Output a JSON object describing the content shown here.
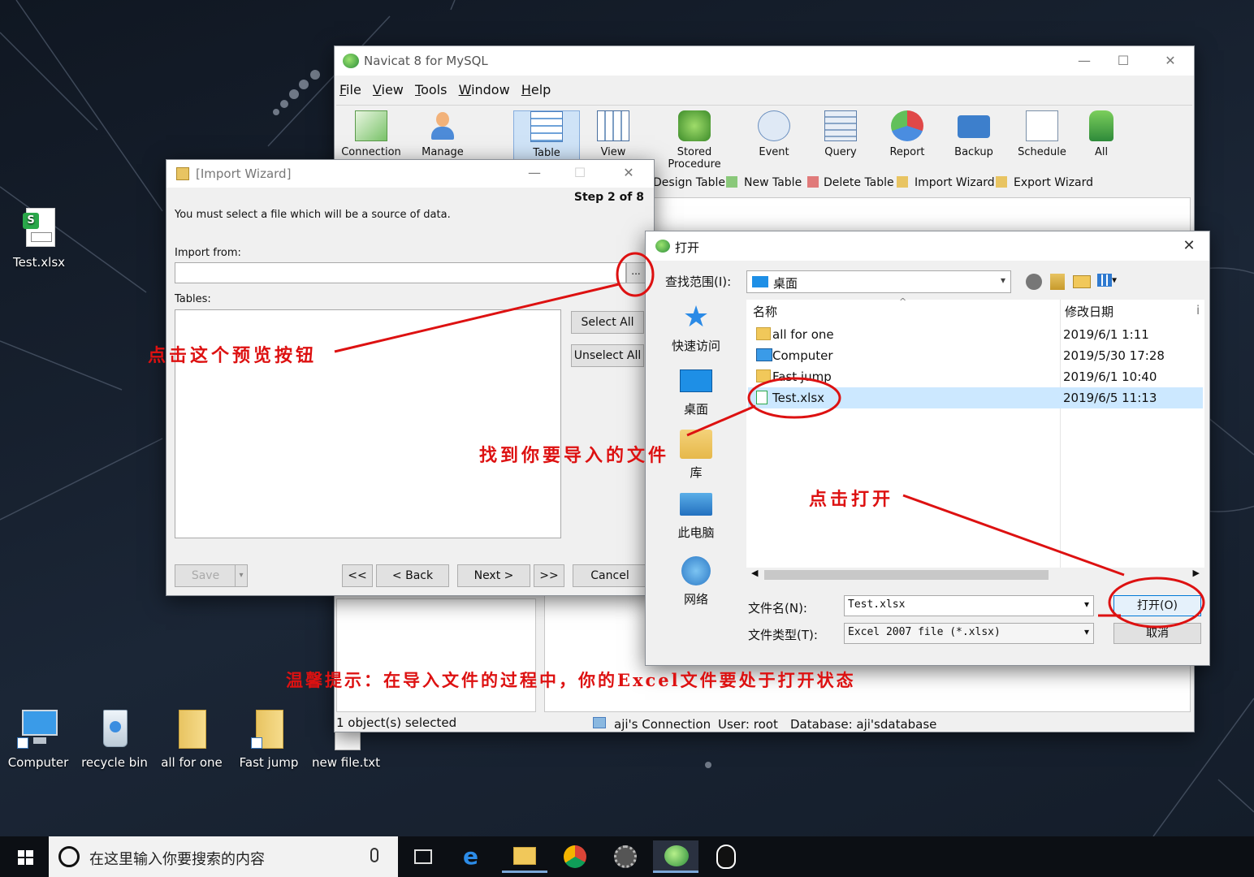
{
  "desktop": {
    "icons": [
      {
        "label": "Test.xlsx"
      },
      {
        "label": "Computer"
      },
      {
        "label": "recycle bin"
      },
      {
        "label": "all for one"
      },
      {
        "label": "Fast jump"
      },
      {
        "label": "new file.txt"
      }
    ]
  },
  "navicat": {
    "title": "Navicat 8 for MySQL",
    "menu": [
      "File",
      "View",
      "Tools",
      "Window",
      "Help"
    ],
    "toolbar": [
      "Connection",
      "Manage Users",
      "Table",
      "View",
      "Stored Procedure",
      "Event",
      "Query",
      "Report",
      "Backup",
      "Schedule",
      "All"
    ],
    "objectbar": [
      "Design Table",
      "New Table",
      "Delete Table",
      "Import Wizard",
      "Export Wizard"
    ],
    "status": {
      "selected": "1 object(s) selected",
      "connection": "aji's Connection",
      "user": "User: root",
      "database": "Database: aji'sdatabase"
    }
  },
  "wizard": {
    "title": "[Import Wizard]",
    "step": "Step 2 of 8",
    "instruction": "You must select a file which will be a source of data.",
    "import_from_label": "Import from:",
    "browse_label": "...",
    "tables_label": "Tables:",
    "select_all": "Select All",
    "unselect_all": "Unselect All",
    "save": "Save",
    "first": "<<",
    "back": "< Back",
    "next": "Next >",
    "last": ">>",
    "cancel": "Cancel"
  },
  "open_dialog": {
    "title": "打开",
    "lookin_label": "查找范围(I):",
    "lookin_value": "桌面",
    "places": [
      "快速访问",
      "桌面",
      "库",
      "此电脑",
      "网络"
    ],
    "col_name": "名称",
    "col_date": "修改日期",
    "files": [
      {
        "name": "all for one",
        "date": "2019/6/1 1:11",
        "type": "folder"
      },
      {
        "name": "Computer",
        "date": "2019/5/30 17:28",
        "type": "shortcut"
      },
      {
        "name": "Fast jump",
        "date": "2019/6/1 10:40",
        "type": "folder"
      },
      {
        "name": "Test.xlsx",
        "date": "2019/6/5 11:13",
        "type": "xlsx",
        "selected": true
      }
    ],
    "filename_label": "文件名(N):",
    "filename_value": "Test.xlsx",
    "filetype_label": "文件类型(T):",
    "filetype_value": "Excel 2007 file (*.xlsx)",
    "open_button": "打开(O)",
    "cancel_button": "取消"
  },
  "annotations": {
    "browse": "点击这个预览按钮",
    "find_file": "找到你要导入的文件",
    "click_open": "点击打开",
    "tip": "温馨提示：在导入文件的过程中，你的Excel文件要处于打开状态"
  },
  "taskbar": {
    "search_placeholder": "在这里输入你要搜索的内容"
  },
  "colors": {
    "annotation": "#dd1111",
    "selection": "#cce8ff",
    "taskbar": "#0c0f14"
  }
}
